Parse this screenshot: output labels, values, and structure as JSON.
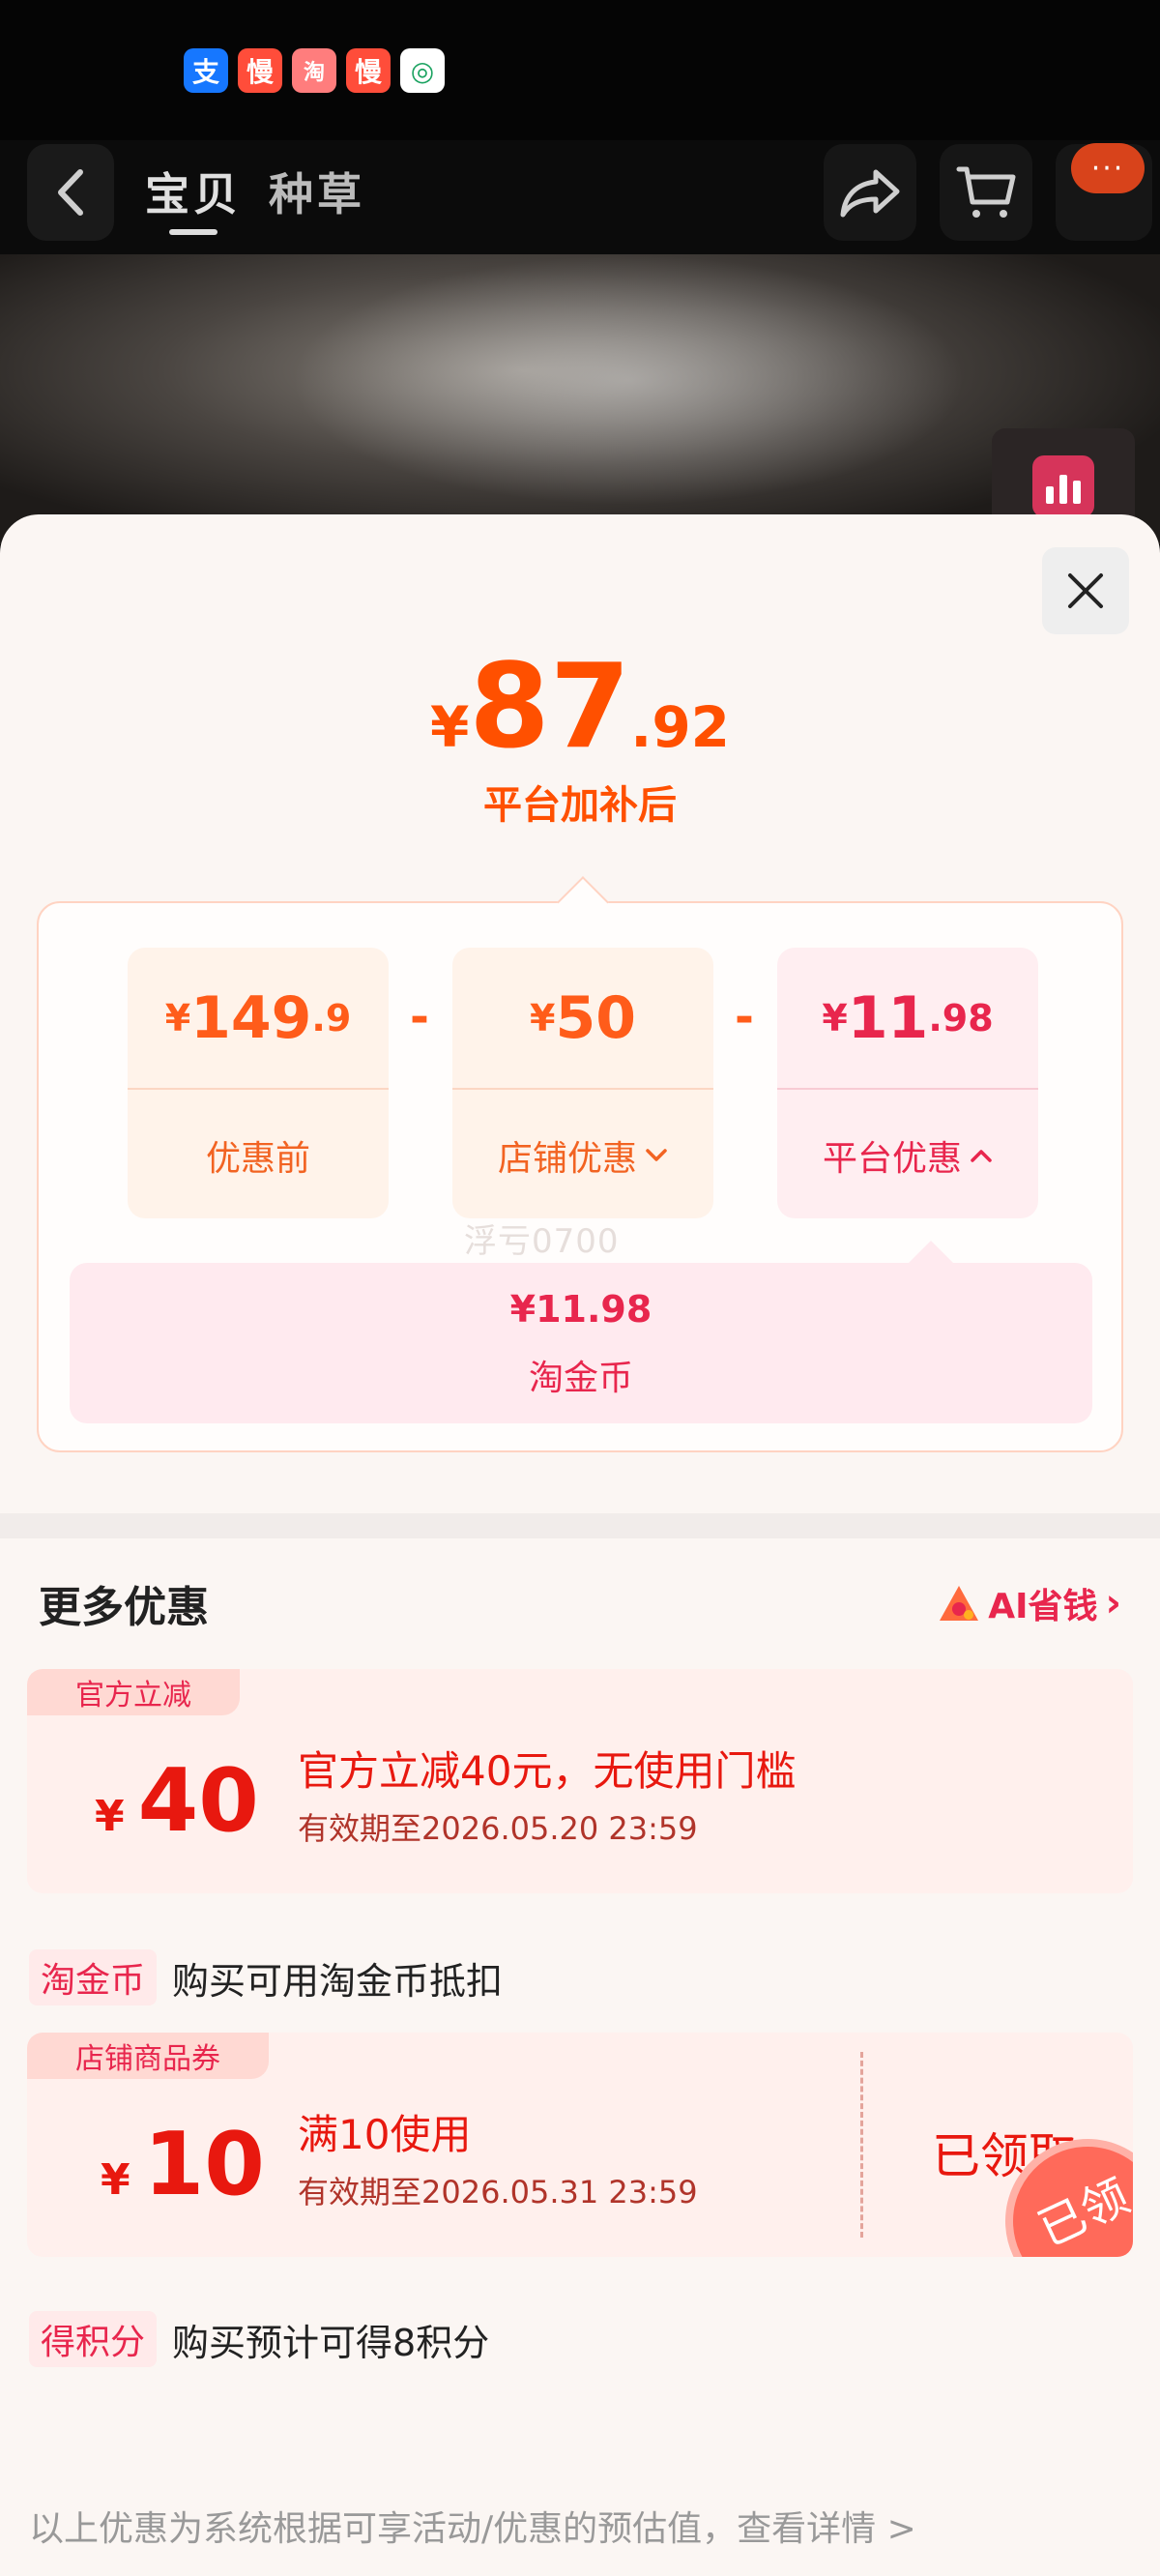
{
  "status_bar": {
    "icons": [
      {
        "name": "alipay-icon",
        "glyph": "支",
        "color": "#1677ff"
      },
      {
        "name": "slow-app-icon",
        "glyph": "慢",
        "color": "#ff4d3a"
      },
      {
        "name": "cartoon-app-icon",
        "glyph": "淘",
        "color": "#ff6b6b"
      },
      {
        "name": "slow-app-icon-2",
        "glyph": "慢",
        "color": "#ff4d3a"
      },
      {
        "name": "china-mobile-icon",
        "glyph": "◎",
        "color": "#ffffff"
      }
    ]
  },
  "nav": {
    "tab_item": "宝贝",
    "tab_grass": "种草",
    "more_dots": "···"
  },
  "price": {
    "symbol": "¥",
    "integer": "87",
    "decimal": ".92",
    "subtitle": "平台加补后"
  },
  "breakdown": {
    "original": {
      "symbol": "¥",
      "integer": "149",
      "decimal": ".9",
      "label": "优惠前"
    },
    "shop": {
      "symbol": "¥",
      "integer": "50",
      "decimal": "",
      "label": "店铺优惠"
    },
    "platform": {
      "symbol": "¥",
      "integer": "11",
      "decimal": ".98",
      "label": "平台优惠"
    },
    "minus": "-",
    "detail_value": "¥11.98",
    "detail_name": "淘金币"
  },
  "watermark": "浮亏0700",
  "more": {
    "title": "更多优惠",
    "ai_link": "AI省钱",
    "ai_chevron": "›"
  },
  "coupons": [
    {
      "tag": "官方立减",
      "symbol": "¥",
      "amount": "40",
      "title": "官方立减40元，无使用门槛",
      "valid": "有效期至2026.05.20 23:59"
    },
    {
      "tag": "店铺商品券",
      "symbol": "¥",
      "amount": "10",
      "title": "满10使用",
      "valid": "有效期至2026.05.31 23:59",
      "status": "已领取",
      "stamp": "已领"
    }
  ],
  "rows": {
    "taojinbi_tag": "淘金币",
    "taojinbi_text": "购买可用淘金币抵扣",
    "points_tag": "得积分",
    "points_text": "购买预计可得8积分"
  },
  "footer": "以上优惠为系统根据可享活动/优惠的预估值，查看详情 >",
  "colors": {
    "accent_orange": "#ff5000",
    "accent_red": "#e8264d"
  }
}
